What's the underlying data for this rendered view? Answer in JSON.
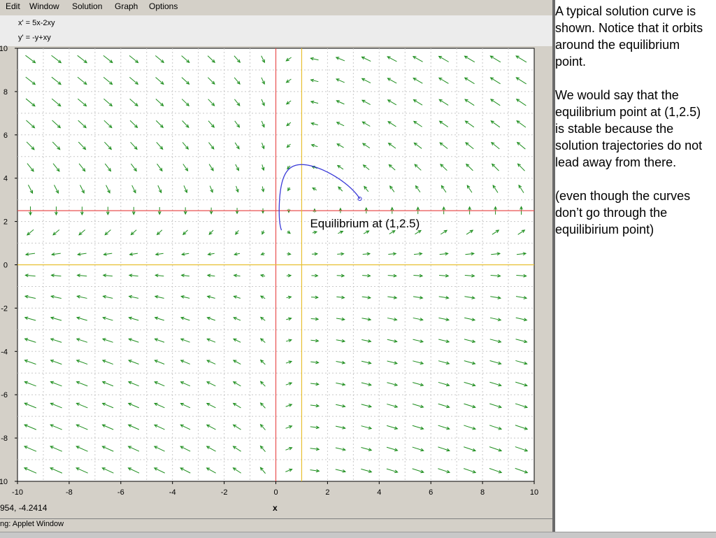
{
  "menu": {
    "items": [
      "Edit",
      "Window",
      "Solution",
      "Graph",
      "Options"
    ]
  },
  "equations": {
    "x_prime": "x' = 5x-2xy",
    "y_prime": "y' = -y+xy"
  },
  "chart_data": {
    "type": "direction-field",
    "system": {
      "dx": "5x-2xy",
      "dy": "-y+xy"
    },
    "xlim": [
      -10,
      10
    ],
    "ylim": [
      -10,
      10
    ],
    "xlabel": "x",
    "ylabel": "",
    "x_ticks": [
      "-10",
      "-8",
      "-6",
      "-4",
      "-2",
      "0",
      "2",
      "4",
      "6",
      "8",
      "10"
    ],
    "y_ticks": [
      "10",
      "8",
      "6",
      "4",
      "2",
      "0",
      "-2",
      "-4",
      "-6",
      "-8",
      "-10"
    ],
    "grid": true,
    "nullclines": [
      {
        "name": "x' = 0 (x = 0)",
        "color": "#e85050"
      },
      {
        "name": "x' = 0 (y = 2.5)",
        "color": "#e85050"
      },
      {
        "name": "y' = 0 (y = 0)",
        "color": "#e8c030"
      },
      {
        "name": "y' = 0 (x = 1)",
        "color": "#e8c030"
      }
    ],
    "equilibrium": {
      "x": 1,
      "y": 2.5
    },
    "solution_curve": {
      "color": "#3a3ad8",
      "initial_point": {
        "x": 3.25,
        "y": 3.05
      }
    },
    "annotation": "Equilibrium at (1,2.5)"
  },
  "colors": {
    "field_arrow": "#1f8f1f",
    "grid": "#c8c8c8"
  },
  "coord_readout": "954, -4.2414",
  "x_axis_label": "x",
  "status": "ng: Applet Window",
  "notes": {
    "p1": "A typical solution curve is shown.  Notice that it orbits around the equilibrium point.",
    "p2": "We would say that the equilibrium point at (1,2.5) is stable because the solution trajectories do not lead away from there.",
    "p3": "(even though the curves don’t go through the equilibirium point)"
  }
}
